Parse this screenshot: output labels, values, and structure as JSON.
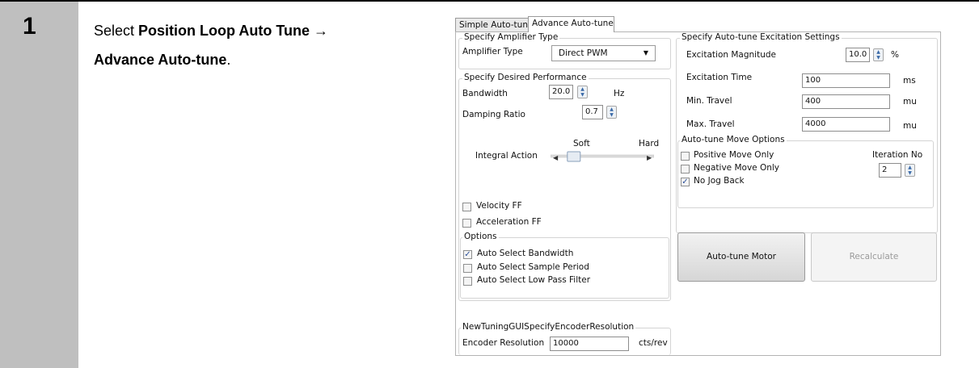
{
  "step": {
    "number": "1"
  },
  "instruction": {
    "prefix": "Select ",
    "bold1": "Position Loop Auto Tune",
    "arrow": " →",
    "bold2": "Advance Auto-tune",
    "suffix": "."
  },
  "tabs": [
    {
      "label": "Simple Auto-tune",
      "active": false
    },
    {
      "label": "Advance Auto-tune",
      "active": true
    }
  ],
  "amplifier": {
    "group_label": "Specify Amplifier Type",
    "type_label": "Amplifier Type",
    "type_value": "Direct PWM"
  },
  "performance": {
    "group_label": "Specify Desired Performance",
    "bandwidth_label": "Bandwidth",
    "bandwidth_value": "20.0",
    "bandwidth_unit": "Hz",
    "damping_label": "Damping Ratio",
    "damping_value": "0.7",
    "integral_label": "Integral Action",
    "soft_label": "Soft",
    "hard_label": "Hard",
    "integral_level": 0.1,
    "velocity_ff": {
      "label": "Velocity FF",
      "checked": false
    },
    "acceleration_ff": {
      "label": "Acceleration FF",
      "checked": false
    }
  },
  "options": {
    "group_label": "Options",
    "auto_bandwidth": {
      "label": "Auto Select Bandwidth",
      "checked": true
    },
    "auto_sample": {
      "label": "Auto Select Sample Period",
      "checked": false
    },
    "auto_lowpass": {
      "label": "Auto Select Low Pass Filter",
      "checked": false
    }
  },
  "excitation": {
    "group_label": "Specify Auto-tune Excitation Settings",
    "magnitude_label": "Excitation Magnitude",
    "magnitude_value": "10.0",
    "magnitude_unit": "%",
    "time_label": "Excitation Time",
    "time_value": "100",
    "time_unit": "ms",
    "min_label": "Min. Travel",
    "min_value": "400",
    "min_unit": "mu",
    "max_label": "Max. Travel",
    "max_value": "4000",
    "max_unit": "mu"
  },
  "move_options": {
    "group_label": "Auto-tune Move Options",
    "positive": {
      "label": "Positive Move Only",
      "checked": false
    },
    "negative": {
      "label": "Negative Move Only",
      "checked": false
    },
    "nojog": {
      "label": "No Jog Back",
      "checked": true
    },
    "iteration_label": "Iteration No",
    "iteration_value": "2"
  },
  "buttons": {
    "autotune_label": "Auto-tune Motor",
    "recalculate_label": "Recalculate"
  },
  "encoder": {
    "group_label": "NewTuningGUISpecifyEncoderResolution",
    "label": "Encoder Resolution",
    "value": "10000",
    "unit": "cts/rev"
  }
}
